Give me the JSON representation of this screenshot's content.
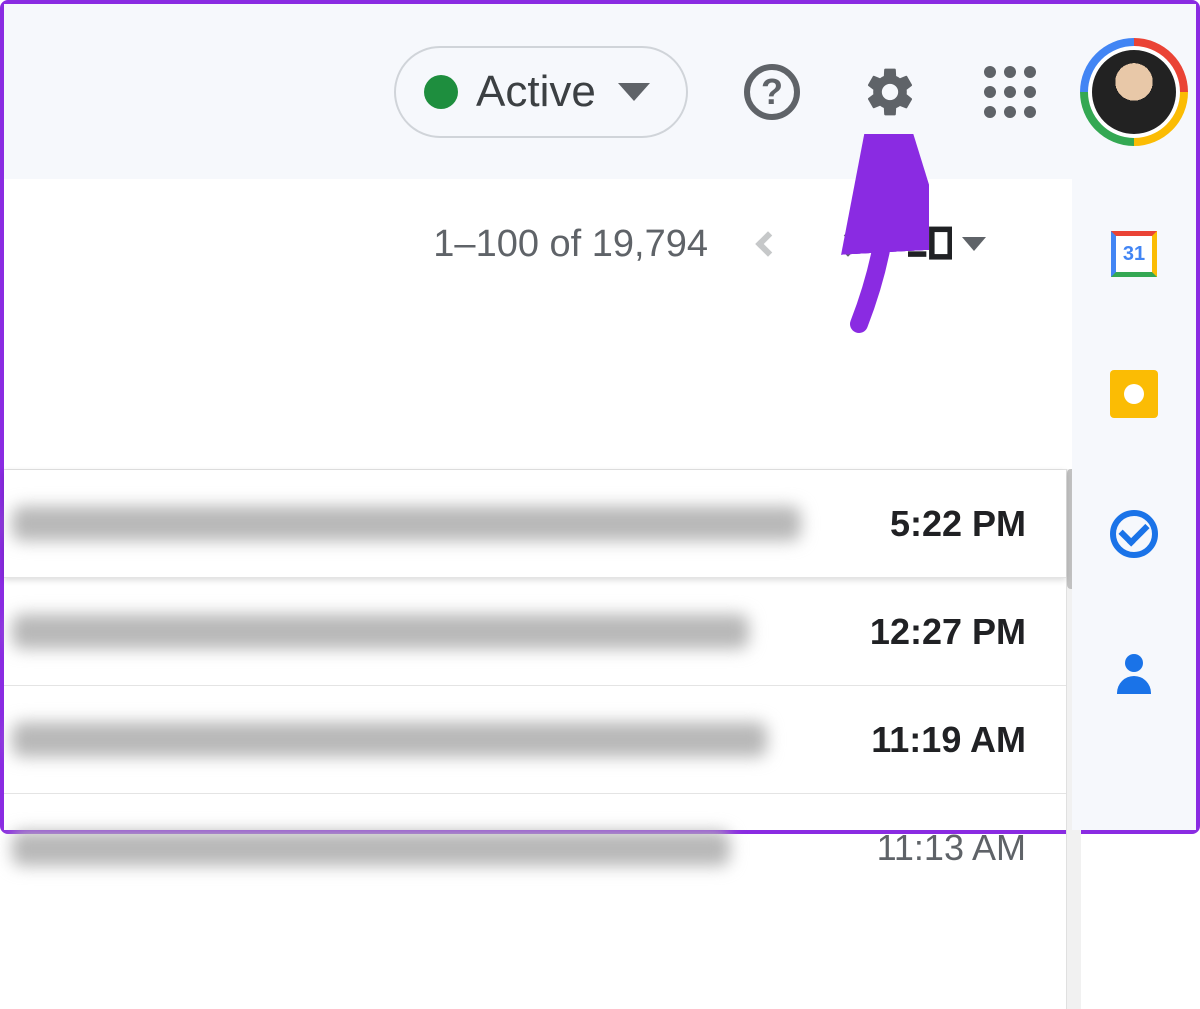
{
  "header": {
    "status_label": "Active"
  },
  "toolbar": {
    "pagination_text": "1–100 of 19,794"
  },
  "emails": [
    {
      "time": "5:22 PM"
    },
    {
      "time": "12:27 PM"
    },
    {
      "time": "11:19 AM"
    },
    {
      "time": "11:13 AM"
    }
  ],
  "side_apps": {
    "calendar_day": "31"
  }
}
